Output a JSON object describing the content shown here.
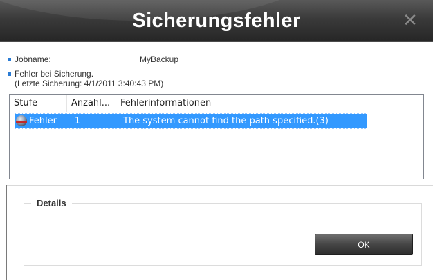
{
  "window": {
    "title": "Sicherungsfehler"
  },
  "info": {
    "job_label": "Jobname:",
    "job_value": "MyBackup",
    "error_line": "Fehler bei Sicherung.",
    "last_backup": "(Letzte Sicherung: 4/1/2011 3:40:43 PM)"
  },
  "table": {
    "columns": [
      "Stufe",
      "Anzahl...",
      "Fehlerinformationen"
    ],
    "rows": [
      {
        "level": "Fehler",
        "count": "1",
        "message": "The system cannot find the path specified.(3)"
      }
    ]
  },
  "details": {
    "legend": "Details"
  },
  "buttons": {
    "ok": "OK"
  },
  "colors": {
    "accent": "#3399ff",
    "bullet": "#2a7bd4",
    "titlebar": "#333333"
  },
  "icons": {
    "close": "close-icon",
    "level": "error-icon",
    "bullet": "bullet-icon"
  }
}
